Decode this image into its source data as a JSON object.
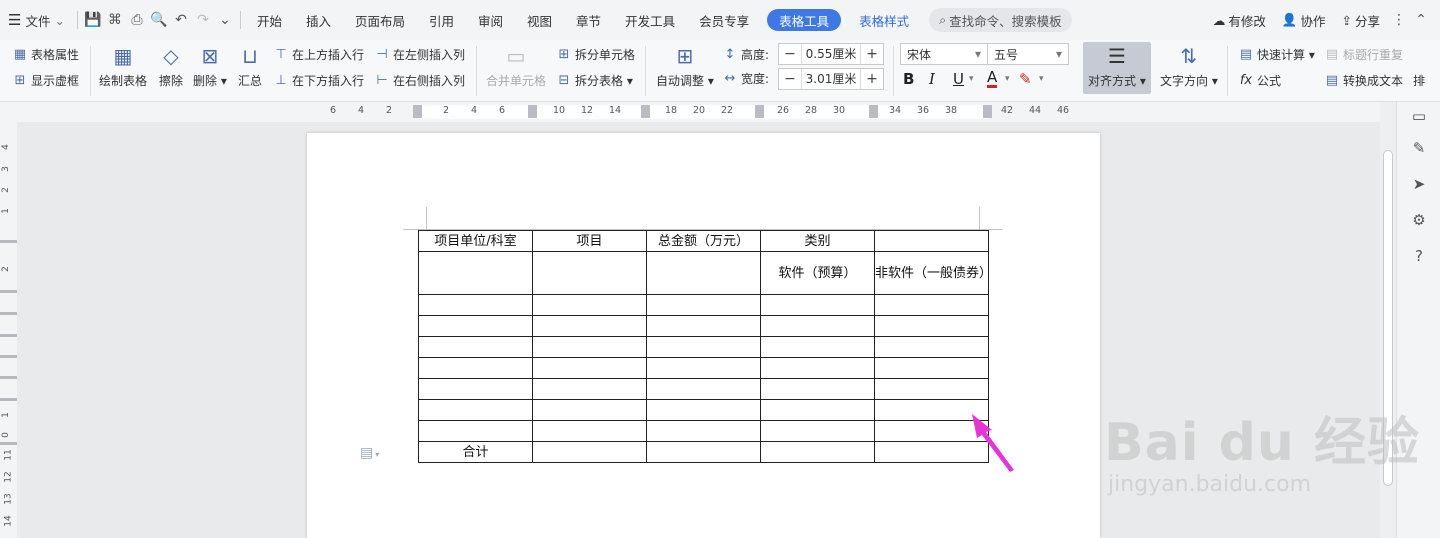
{
  "menubar": {
    "file": "文件",
    "tabs": [
      "开始",
      "插入",
      "页面布局",
      "引用",
      "审阅",
      "视图",
      "章节",
      "开发工具",
      "会员专享"
    ],
    "active_tab": "表格工具",
    "style_tab": "表格样式",
    "search": "查找命令、搜索模板",
    "modify": "有修改",
    "collab": "协作",
    "share": "分享"
  },
  "ribbon": {
    "table_props": "表格属性",
    "show_grid": "显示虚框",
    "draw_table": "绘制表格",
    "erase": "擦除",
    "delete": "删除",
    "summary": "汇总",
    "insert_above": "在上方插入行",
    "insert_below": "在下方插入行",
    "insert_left": "在左侧插入列",
    "insert_right": "在右侧插入列",
    "merge_cells": "合并单元格",
    "split_cells": "拆分单元格",
    "split_table": "拆分表格",
    "auto_adjust": "自动调整",
    "height_label": "高度:",
    "height_value": "0.55厘米",
    "width_label": "宽度:",
    "width_value": "3.01厘米",
    "font": "宋体",
    "size": "五号",
    "align": "对齐方式",
    "text_dir": "文字方向",
    "quick_calc": "快速计算",
    "formula": "公式",
    "title_repeat": "标题行重复",
    "to_text": "转换成文本",
    "more": "排"
  },
  "ruler": {
    "numbers": [
      "6",
      "4",
      "2",
      "2",
      "4",
      "6",
      "10",
      "12",
      "14",
      "18",
      "20",
      "22",
      "26",
      "28",
      "30",
      "34",
      "36",
      "38",
      "42",
      "44",
      "46"
    ],
    "vertical": [
      "4",
      "3",
      "2",
      "1",
      "2",
      "1",
      "0",
      "11",
      "12",
      "13",
      "14"
    ]
  },
  "table": {
    "header": [
      "项目单位/科室",
      "项目",
      "总金额（万元）",
      "类别",
      ""
    ],
    "subheader": [
      "",
      "",
      "",
      "软件（预算）",
      "非软件（一般债券）"
    ],
    "total_label": "合计"
  },
  "watermark": {
    "brand": "Bai du 经验",
    "url": "jingyan.baidu.com"
  },
  "colors": {
    "active_tab": "#3d78e4",
    "arrow": "#e535d6"
  }
}
